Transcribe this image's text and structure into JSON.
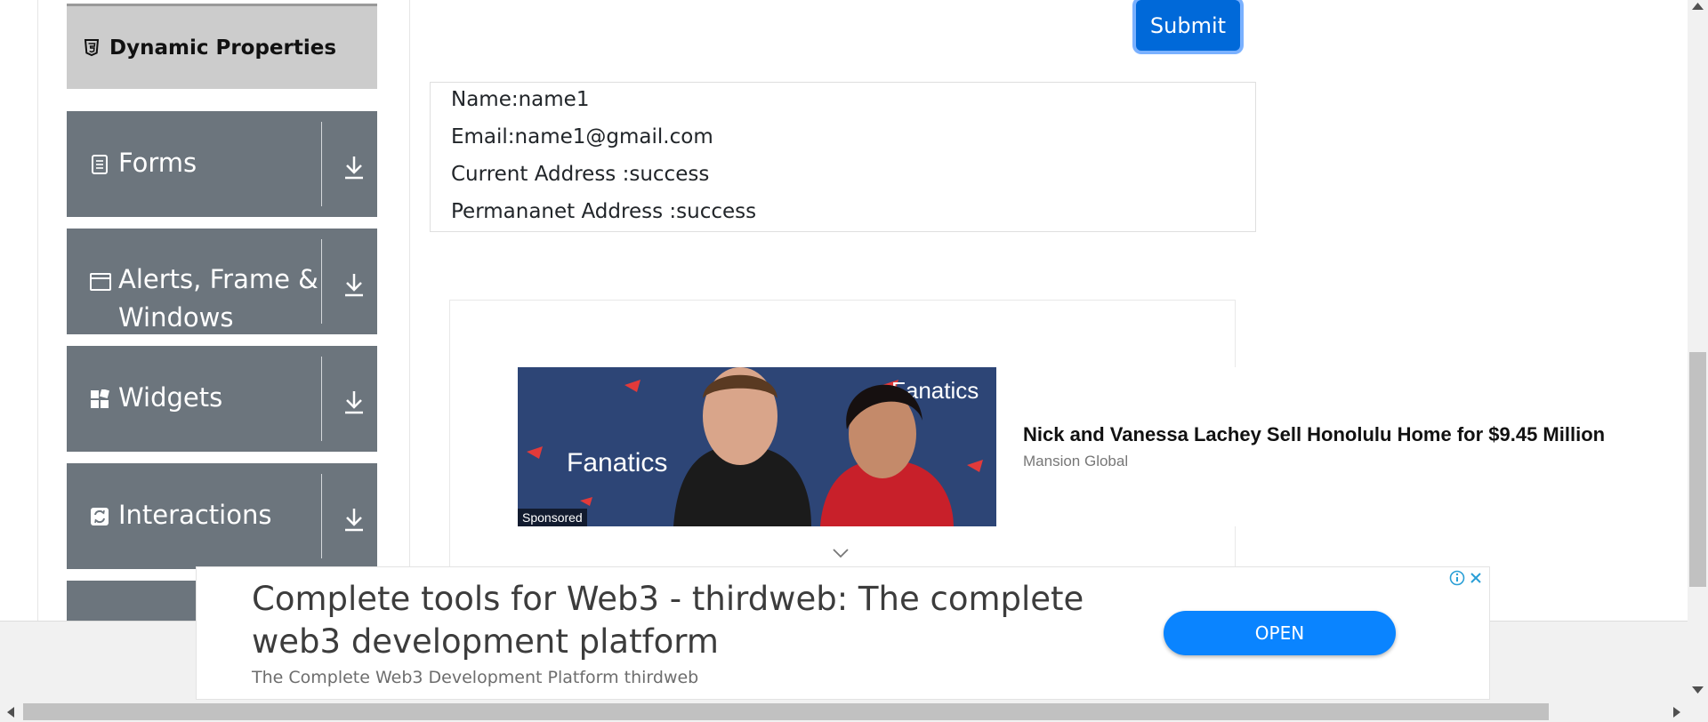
{
  "sidebar": {
    "active_item": "Dynamic Properties",
    "groups": [
      {
        "label": "Forms",
        "icon": "form-icon"
      },
      {
        "label": "Alerts, Frame & Windows",
        "icon": "window-icon"
      },
      {
        "label": "Widgets",
        "icon": "widgets-icon"
      },
      {
        "label": "Interactions",
        "icon": "interactions-icon"
      }
    ]
  },
  "form": {
    "submit_label": "Submit",
    "output": {
      "name": "Name:name1",
      "email": "Email:name1@gmail.com",
      "current_address": "Current Address :success",
      "permanent_address": "Permananet Address :success"
    }
  },
  "sponsored_ad": {
    "badge": "Sponsored",
    "title": "Nick and Vanessa Lachey Sell Honolulu Home for $9.45 Million",
    "source": "Mansion Global",
    "photo_text": "Fanatics"
  },
  "banner_ad": {
    "title": "Complete tools for Web3 - thirdweb: The complete web3 development platform",
    "subtitle": "The Complete Web3 Development Platform thirdweb",
    "button_label": "OPEN"
  },
  "colors": {
    "sidebar_group": "#6c757d",
    "active_item_bg": "#cccccc",
    "primary": "#0069d9",
    "open_button": "#0a84ff"
  }
}
